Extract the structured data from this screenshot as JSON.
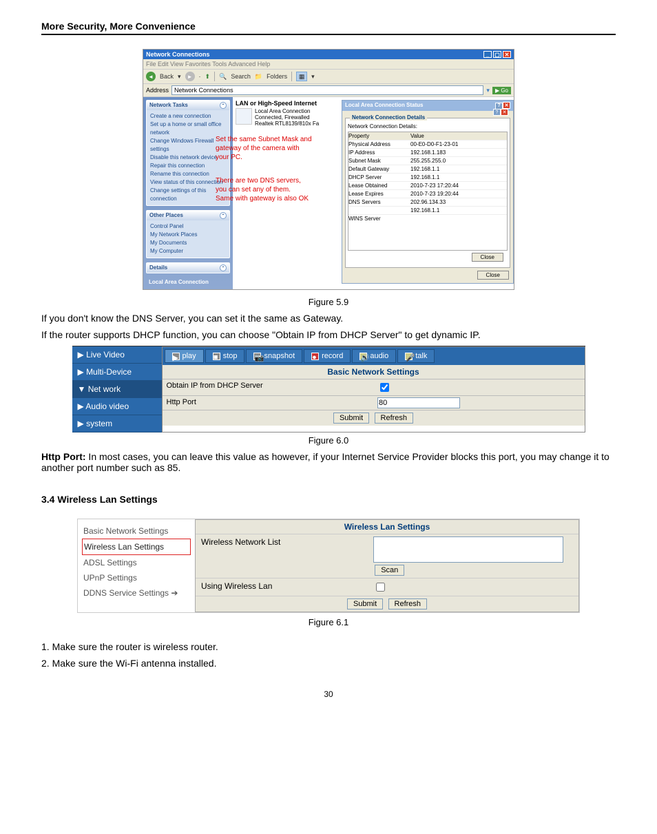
{
  "header": "More Security, More Convenience",
  "page_number": "30",
  "win": {
    "title": "Network Connections",
    "menu": "File   Edit   View   Favorites   Tools   Advanced   Help",
    "toolbar": {
      "back": "Back",
      "search": "Search",
      "folders": "Folders"
    },
    "address_label": "Address",
    "address_value": "Network Connections",
    "go": "Go",
    "sidebar": {
      "tasks_head": "Network Tasks",
      "tasks": [
        "Create a new connection",
        "Set up a home or small office network",
        "Change Windows Firewall settings",
        "Disable this network device",
        "Repair this connection",
        "Rename this connection",
        "View status of this connection",
        "Change settings of this connection"
      ],
      "places_head": "Other Places",
      "places": [
        "Control Panel",
        "My Network Places",
        "My Documents",
        "My Computer"
      ],
      "details_head": "Details",
      "details_item": "Local Area Connection"
    },
    "main": {
      "group": "LAN or High-Speed Internet",
      "conn_name": "Local Area Connection",
      "conn_status": "Connected, Firewalled",
      "conn_adapter": "Realtek RTL8139/810x Fa"
    },
    "overlay1": "Set the same Subnet Mask and\ngateway of the camera with\nyour PC.",
    "overlay2": "There are two DNS servers,\nyou can set any of them.\nSame with gateway is also OK",
    "status": {
      "title": "Local Area Connection Status",
      "details_group": "Network Connection Details",
      "details_label": "Network Connection Details:",
      "prop_head": "Property",
      "val_head": "Value",
      "rows": [
        {
          "p": "Physical Address",
          "v": "00-E0-D0-F1-23-01"
        },
        {
          "p": "IP Address",
          "v": "192.168.1.183"
        },
        {
          "p": "Subnet Mask",
          "v": "255.255.255.0"
        },
        {
          "p": "Default Gateway",
          "v": "192.168.1.1"
        },
        {
          "p": "DHCP Server",
          "v": "192.168.1.1"
        },
        {
          "p": "Lease Obtained",
          "v": "2010-7-23 17:20:44"
        },
        {
          "p": "Lease Expires",
          "v": "2010-7-23 19:20:44"
        },
        {
          "p": "DNS Servers",
          "v": "202.96.134.33"
        },
        {
          "p": "",
          "v": "192.168.1.1"
        },
        {
          "p": "WINS Server",
          "v": ""
        }
      ],
      "close": "Close"
    }
  },
  "fig59_caption": "Figure 5.9",
  "para1": "If you don't know the DNS Server, you can set it the same as Gateway.",
  "para2": "If the router supports DHCP function, you can choose \"Obtain IP from DHCP Server\" to get dynamic IP.",
  "cam": {
    "side": [
      "Live Video",
      "Multi-Device",
      "Net work",
      "Audio video",
      "system"
    ],
    "toolbar": [
      "play",
      "stop",
      "snapshot",
      "record",
      "audio",
      "talk"
    ],
    "sub_title": "Basic Network Settings",
    "row1_label": "Obtain IP from DHCP Server",
    "row2_label": "Http Port",
    "row2_value": "80",
    "submit": "Submit",
    "refresh": "Refresh"
  },
  "fig60_caption": "Figure 6.0",
  "para3_prefix": "Http Port:",
  "para3_body": " In most cases, you can leave this value as however, if your Internet Service Provider blocks this port, you may change it to another port number such as 85.",
  "section34": "3.4 Wireless Lan Settings",
  "fig61": {
    "menu": [
      "Basic Network Settings",
      "Wireless Lan Settings",
      "ADSL Settings",
      "UPnP Settings",
      "DDNS Service Settings"
    ],
    "title": "Wireless Lan Settings",
    "row1_label": "Wireless Network List",
    "scan": "Scan",
    "row2_label": "Using Wireless Lan",
    "submit": "Submit",
    "refresh": "Refresh"
  },
  "fig61_caption": "Figure 6.1",
  "note1": "1. Make sure the router is wireless router.",
  "note2": "2. Make sure the Wi-Fi antenna installed."
}
